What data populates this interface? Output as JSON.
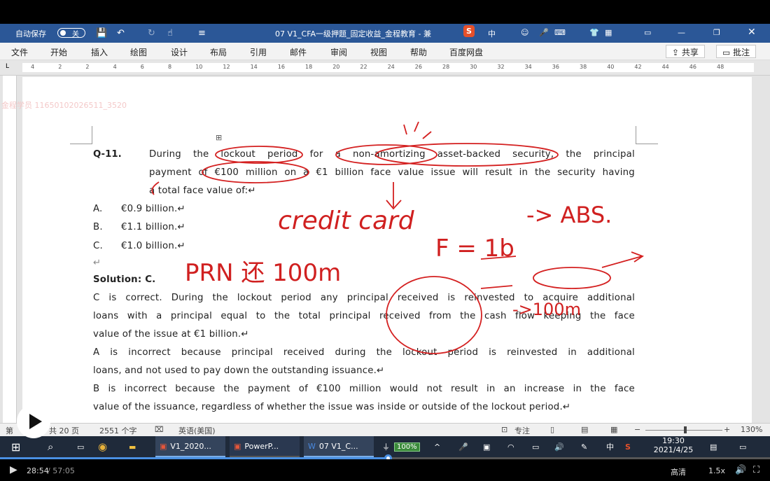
{
  "titlebar": {
    "autosave": "自动保存",
    "autosave_state": "关",
    "doc_title": "07 V1_CFA一级押题_固定收益_金程教育 - 兼",
    "ime_lang": "中"
  },
  "ribbon": {
    "tabs": [
      "文件",
      "开始",
      "插入",
      "绘图",
      "设计",
      "布局",
      "引用",
      "邮件",
      "审阅",
      "视图",
      "帮助",
      "百度网盘"
    ],
    "share": "共享",
    "comment": "批注"
  },
  "ruler": {
    "ticks": [
      "4",
      "2",
      "2",
      "4",
      "6",
      "8",
      "10",
      "12",
      "14",
      "16",
      "18",
      "20",
      "22",
      "24",
      "26",
      "28",
      "30",
      "32",
      "34",
      "36",
      "38",
      "40",
      "42",
      "44",
      "46",
      "48"
    ]
  },
  "watermark": "金程学员 11650102026511_3520",
  "document": {
    "q_num": "Q-11.",
    "q_line1": [
      "During",
      "the",
      "lockout",
      "period",
      "for",
      "a",
      "non-amortizing",
      "asset-backed",
      "security,",
      "the",
      "principal"
    ],
    "q_line2": [
      "payment",
      "of",
      "€100",
      "million",
      "on",
      "a",
      "€1",
      "billion",
      "face",
      "value",
      "issue",
      "will",
      "result",
      "in",
      "the",
      "security",
      "having"
    ],
    "q_line3": "a total face value of:↵",
    "options": [
      {
        "letter": "A.",
        "text": "€0.9 billion.↵"
      },
      {
        "letter": "B.",
        "text": "€1.1 billion.↵"
      },
      {
        "letter": "C.",
        "text": "€1.0 billion.↵"
      }
    ],
    "blank": "↵",
    "solution": "Solution: C.",
    "sol_lines": [
      [
        "C",
        "is",
        "correct.",
        "During",
        "the",
        "lockout",
        "period",
        "any",
        "principal",
        "received",
        "is",
        "reinvested",
        "to",
        "acquire",
        "additional"
      ],
      [
        "loans",
        "with",
        "a",
        "principal",
        "equal",
        "to",
        "the",
        "total",
        "principal",
        "received",
        "from",
        "the",
        "cash",
        "flow",
        "keeping",
        "the",
        "face"
      ],
      "value of the issue at €1 billion.↵",
      [
        "A",
        "is",
        "incorrect",
        "because",
        "principal",
        "received",
        "during",
        "the",
        "lockout",
        "period",
        "is",
        "reinvested",
        "in",
        "additional"
      ],
      "loans, and not used to pay down the outstanding issuance.↵",
      [
        "B",
        "is",
        "incorrect",
        "because",
        "the",
        "payment",
        "of",
        "€100",
        "million",
        "would",
        "not",
        "result",
        "in",
        "an",
        "increase",
        "in",
        "the",
        "face"
      ],
      "value of the issuance, regardless of whether the issue was inside or outside of the lockout period.↵"
    ]
  },
  "annotations": {
    "credit_card": "credit card",
    "arrow_abs": "-> ABS.",
    "f_eq": "F = 1b",
    "prn": "PRN 还 100m",
    "pay": "->100m"
  },
  "status": {
    "page_prefix": "第",
    "pages": "共 20 页",
    "words": "2551 个字",
    "lang": "英语(美国)",
    "focus": "专注",
    "zoom": "130%"
  },
  "taskbar": {
    "apps": [
      "V1_2020...",
      "PowerP...",
      "07 V1_C..."
    ],
    "battery": "100%",
    "ime": "中",
    "time": "19:30",
    "date": "2021/4/25"
  },
  "player": {
    "current": "28:54",
    "total": "/ 57:05",
    "quality": "高清",
    "speed": "1.5x",
    "progress": 0.505
  }
}
